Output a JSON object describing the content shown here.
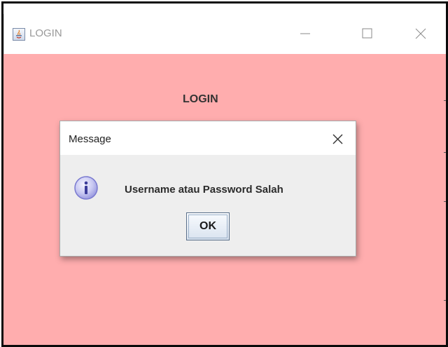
{
  "window": {
    "title": "LOGIN",
    "icon": "java-app-icon",
    "controls": [
      "minimize-icon",
      "maximize-icon",
      "close-icon"
    ]
  },
  "form": {
    "title": "LOGIN",
    "background_color": "#ffadae"
  },
  "dialog": {
    "title": "Message",
    "icon": "info-icon",
    "message": "Username atau Password Salah",
    "ok_label": "OK",
    "close_icon": "close-icon"
  }
}
